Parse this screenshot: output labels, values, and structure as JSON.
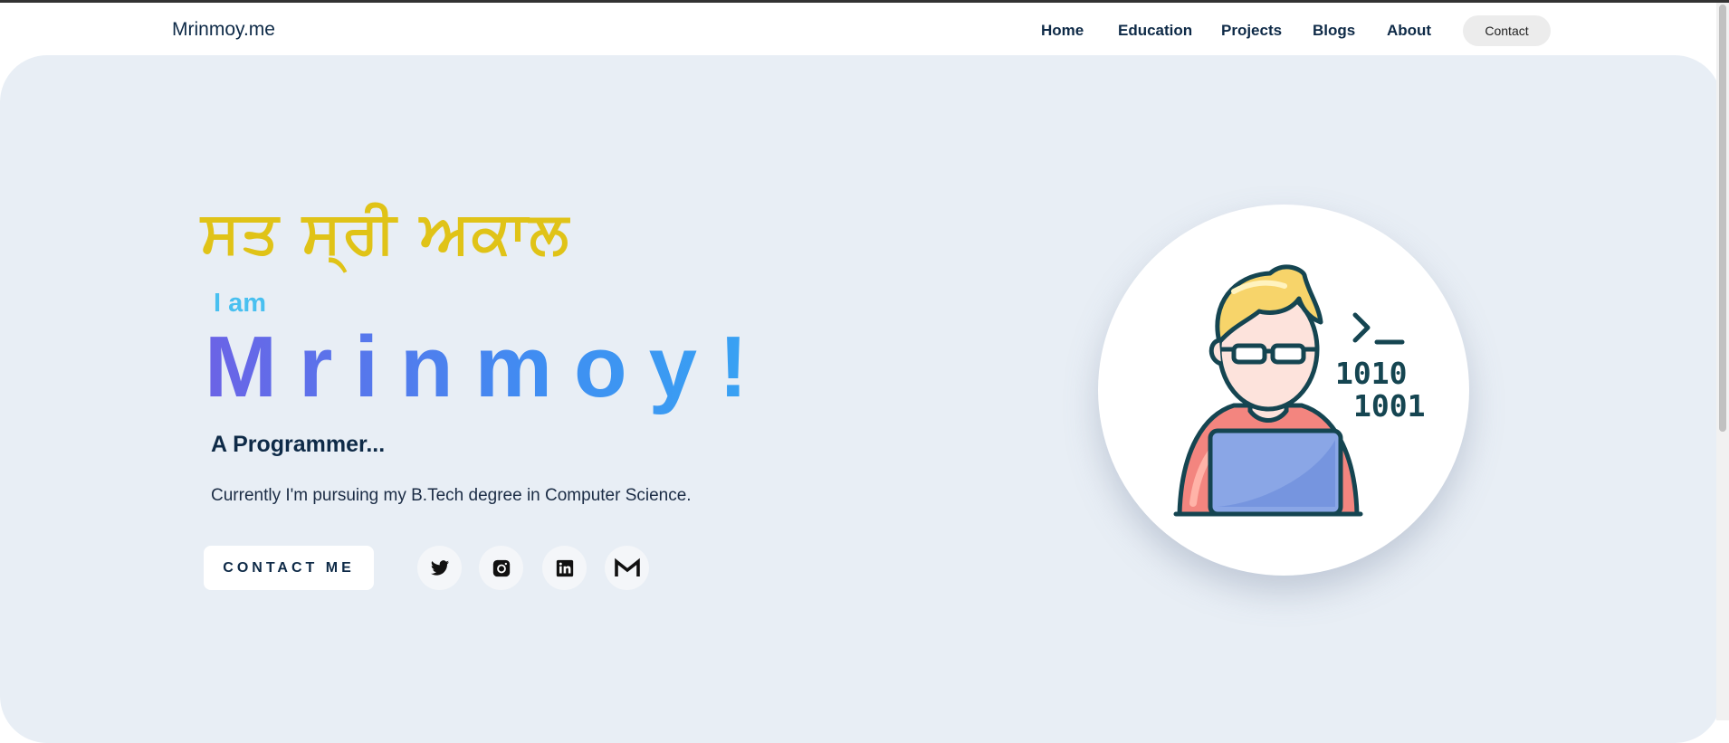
{
  "brand": "Mrinmoy.me",
  "nav": {
    "items": [
      {
        "label": "Home"
      },
      {
        "label": "Education"
      },
      {
        "label": "Projects"
      },
      {
        "label": "Blogs"
      },
      {
        "label": "About"
      }
    ],
    "contact_label": "Contact"
  },
  "hero": {
    "greeting": "ਸਤ ਸ੍ਰੀ ਅਕਾਲ",
    "intro": "I am",
    "name": "Mrinmoy!",
    "tagline": "A Programmer...",
    "description": "Currently I'm pursuing my B.Tech degree in Computer Science.",
    "cta_label": "CONTACT ME",
    "avatar_code_text": {
      "prompt": ">_",
      "line1": "1010",
      "line2": "1001"
    }
  },
  "social": [
    {
      "icon": "twitter-icon"
    },
    {
      "icon": "instagram-icon"
    },
    {
      "icon": "linkedin-icon"
    },
    {
      "icon": "gmail-icon"
    }
  ],
  "colors": {
    "navy": "#0e2a47",
    "greeting_yellow": "#e0c317",
    "intro_blue": "#49c0f0",
    "name_gradient_start": "#6b63e6",
    "name_gradient_end": "#38a4f3",
    "hero_background": "#e8eef5"
  }
}
